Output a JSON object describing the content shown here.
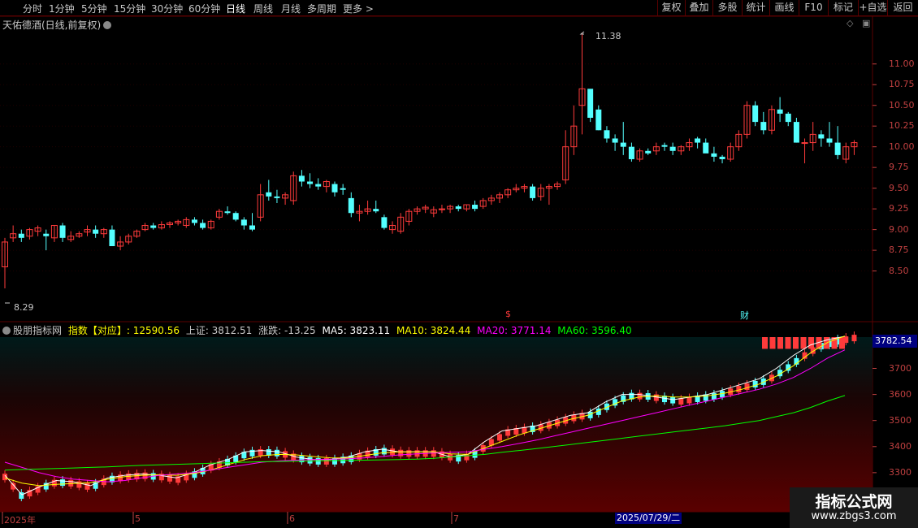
{
  "toolbar": {
    "periods": [
      "分时",
      "1分钟",
      "5分钟",
      "15分钟",
      "30分钟",
      "60分钟",
      "日线",
      "周线",
      "月线",
      "多周期",
      "更多 >"
    ],
    "active_period": "日线",
    "right_buttons": [
      "复权",
      "叠加",
      "多股",
      "统计",
      "画线",
      "F10",
      "+自选",
      "返回"
    ],
    "right_extra": "标记"
  },
  "main_panel": {
    "title": "天佑德酒(日线,前复权)",
    "high_label": "11.38",
    "low_label": "8.29",
    "marker_s": "$",
    "marker_cai": "财",
    "price_axis": [
      "11.00",
      "10.75",
      "10.50",
      "10.25",
      "10.00",
      "9.75",
      "9.50",
      "9.25",
      "9.00",
      "8.75",
      "8.50"
    ]
  },
  "indicator_panel": {
    "title": "股朋指标网",
    "index_label": "指数【对应】",
    "index_value": ": 12590.56",
    "sh_label": "上证: 3812.51",
    "change_label": "涨跌: -13.25",
    "ma5": "MA5: 3823.11",
    "ma10": "MA10: 3824.44",
    "ma20": "MA20: 3771.14",
    "ma60": "MA60: 3596.40",
    "current_value": "3782.54",
    "axis": [
      "3700",
      "3600",
      "3500",
      "3400",
      "3300",
      "3200"
    ]
  },
  "date_axis": {
    "labels": [
      "2025年",
      "5",
      "6",
      "7"
    ],
    "cursor_date": "2025/07/29/二"
  },
  "watermark": {
    "line1": "指标公式网",
    "line2": "www.zbgs3.com"
  },
  "colors": {
    "up": "#ff3b3b",
    "down": "#54ffff",
    "ma5": "#ffffff",
    "ma10": "#ffff00",
    "ma20": "#ff00ff",
    "ma60": "#00ff00",
    "grid": "#5a0000"
  },
  "chart_data": [
    {
      "type": "candlestick",
      "title": "天佑德酒(日线,前复权)",
      "ylim": [
        8.29,
        11.38
      ],
      "candles": [
        [
          8.55,
          8.9,
          8.29,
          8.85
        ],
        [
          8.9,
          9.05,
          8.85,
          8.95
        ],
        [
          8.95,
          9.0,
          8.85,
          8.9
        ],
        [
          8.92,
          9.02,
          8.88,
          9.0
        ],
        [
          8.98,
          9.05,
          8.92,
          9.02
        ],
        [
          8.95,
          9.0,
          8.75,
          8.92
        ],
        [
          8.9,
          9.05,
          8.85,
          9.05
        ],
        [
          9.05,
          9.08,
          8.85,
          8.9
        ],
        [
          8.88,
          8.98,
          8.85,
          8.92
        ],
        [
          8.92,
          8.98,
          8.9,
          8.95
        ],
        [
          8.97,
          9.05,
          8.92,
          9.0
        ],
        [
          9.0,
          9.05,
          8.9,
          8.95
        ],
        [
          8.95,
          9.02,
          8.9,
          9.0
        ],
        [
          9.0,
          9.05,
          8.85,
          8.8
        ],
        [
          8.8,
          8.92,
          8.75,
          8.85
        ],
        [
          8.85,
          8.95,
          8.82,
          8.92
        ],
        [
          8.92,
          9.0,
          8.9,
          8.98
        ],
        [
          9.0,
          9.08,
          8.98,
          9.05
        ],
        [
          9.05,
          9.08,
          9.0,
          9.02
        ],
        [
          9.02,
          9.1,
          9.0,
          9.06
        ],
        [
          9.06,
          9.1,
          9.02,
          9.08
        ],
        [
          9.08,
          9.12,
          9.05,
          9.1
        ],
        [
          9.05,
          9.15,
          9.02,
          9.12
        ],
        [
          9.12,
          9.15,
          9.05,
          9.08
        ],
        [
          9.08,
          9.12,
          9.0,
          9.02
        ],
        [
          9.02,
          9.12,
          9.0,
          9.1
        ],
        [
          9.15,
          9.25,
          9.12,
          9.22
        ],
        [
          9.22,
          9.28,
          9.18,
          9.2
        ],
        [
          9.2,
          9.22,
          9.1,
          9.12
        ],
        [
          9.12,
          9.15,
          9.0,
          9.05
        ],
        [
          9.05,
          9.2,
          8.98,
          9.0
        ],
        [
          9.15,
          9.55,
          9.1,
          9.42
        ],
        [
          9.45,
          9.6,
          9.35,
          9.4
        ],
        [
          9.4,
          9.48,
          9.32,
          9.38
        ],
        [
          9.38,
          9.45,
          9.3,
          9.42
        ],
        [
          9.35,
          9.7,
          9.3,
          9.65
        ],
        [
          9.65,
          9.72,
          9.52,
          9.58
        ],
        [
          9.58,
          9.68,
          9.5,
          9.55
        ],
        [
          9.55,
          9.62,
          9.48,
          9.52
        ],
        [
          9.52,
          9.6,
          9.45,
          9.58
        ],
        [
          9.55,
          9.58,
          9.4,
          9.45
        ],
        [
          9.5,
          9.55,
          9.42,
          9.48
        ],
        [
          9.38,
          9.45,
          9.15,
          9.2
        ],
        [
          9.2,
          9.3,
          9.1,
          9.22
        ],
        [
          9.22,
          9.35,
          9.18,
          9.25
        ],
        [
          9.25,
          9.35,
          9.2,
          9.22
        ],
        [
          9.15,
          9.18,
          9.0,
          9.02
        ],
        [
          9.0,
          9.1,
          8.95,
          9.05
        ],
        [
          8.98,
          9.2,
          8.95,
          9.15
        ],
        [
          9.1,
          9.25,
          9.05,
          9.22
        ],
        [
          9.22,
          9.28,
          9.18,
          9.25
        ],
        [
          9.25,
          9.3,
          9.2,
          9.27
        ],
        [
          9.2,
          9.28,
          9.15,
          9.24
        ],
        [
          9.24,
          9.3,
          9.2,
          9.25
        ],
        [
          9.25,
          9.3,
          9.2,
          9.28
        ],
        [
          9.28,
          9.3,
          9.22,
          9.25
        ],
        [
          9.25,
          9.3,
          9.22,
          9.3
        ],
        [
          9.3,
          9.35,
          9.22,
          9.25
        ],
        [
          9.28,
          9.38,
          9.25,
          9.35
        ],
        [
          9.35,
          9.42,
          9.3,
          9.38
        ],
        [
          9.38,
          9.45,
          9.32,
          9.42
        ],
        [
          9.42,
          9.5,
          9.38,
          9.48
        ],
        [
          9.48,
          9.55,
          9.45,
          9.5
        ],
        [
          9.5,
          9.55,
          9.45,
          9.52
        ],
        [
          9.52,
          9.55,
          9.35,
          9.38
        ],
        [
          9.4,
          9.55,
          9.35,
          9.5
        ],
        [
          9.5,
          9.55,
          9.3,
          9.52
        ],
        [
          9.52,
          9.58,
          9.48,
          9.55
        ],
        [
          9.6,
          10.2,
          9.55,
          10.0
        ],
        [
          10.0,
          10.5,
          9.9,
          10.25
        ],
        [
          10.5,
          11.38,
          10.15,
          10.7
        ],
        [
          10.7,
          10.6,
          10.3,
          10.35
        ],
        [
          10.45,
          10.5,
          10.2,
          10.2
        ],
        [
          10.2,
          10.25,
          10.05,
          10.1
        ],
        [
          10.1,
          10.15,
          9.95,
          10.05
        ],
        [
          10.05,
          10.3,
          9.9,
          10.0
        ],
        [
          10.0,
          10.05,
          9.82,
          9.85
        ],
        [
          9.85,
          9.98,
          9.82,
          9.95
        ],
        [
          9.95,
          9.98,
          9.9,
          9.92
        ],
        [
          9.95,
          10.05,
          9.9,
          10.0
        ],
        [
          10.02,
          10.05,
          9.95,
          10.0
        ],
        [
          10.0,
          10.05,
          9.9,
          9.95
        ],
        [
          9.95,
          10.02,
          9.9,
          10.0
        ],
        [
          10.0,
          10.1,
          9.95,
          10.05
        ],
        [
          10.1,
          10.12,
          9.98,
          10.05
        ],
        [
          10.05,
          10.1,
          9.95,
          9.92
        ],
        [
          9.92,
          10.0,
          9.82,
          9.88
        ],
        [
          9.88,
          9.9,
          9.8,
          9.85
        ],
        [
          9.85,
          10.05,
          9.82,
          10.0
        ],
        [
          10.0,
          10.2,
          9.95,
          10.15
        ],
        [
          10.15,
          10.55,
          10.1,
          10.5
        ],
        [
          10.5,
          10.55,
          10.25,
          10.3
        ],
        [
          10.3,
          10.42,
          10.15,
          10.2
        ],
        [
          10.2,
          10.5,
          10.15,
          10.45
        ],
        [
          10.45,
          10.6,
          10.3,
          10.4
        ],
        [
          10.4,
          10.42,
          10.25,
          10.3
        ],
        [
          10.3,
          10.35,
          10.05,
          10.05
        ],
        [
          10.05,
          10.1,
          9.8,
          10.05
        ],
        [
          10.05,
          10.3,
          9.95,
          10.15
        ],
        [
          10.15,
          10.2,
          10.0,
          10.1
        ],
        [
          10.1,
          10.3,
          10.0,
          10.05
        ],
        [
          10.05,
          10.25,
          9.85,
          9.9
        ],
        [
          9.85,
          10.05,
          9.8,
          10.0
        ],
        [
          10.0,
          10.08,
          9.9,
          10.05
        ]
      ]
    },
    {
      "type": "line",
      "title": "股朋指标网",
      "ylim": [
        3150,
        3820
      ],
      "series": [
        {
          "name": "MA5",
          "values": [
            3290,
            3215,
            3245,
            3270,
            3265,
            3250,
            3280,
            3290,
            3295,
            3290,
            3280,
            3300,
            3330,
            3350,
            3380,
            3385,
            3380,
            3360,
            3350,
            3350,
            3360,
            3380,
            3390,
            3380,
            3380,
            3380,
            3360,
            3370,
            3420,
            3460,
            3470,
            3480,
            3500,
            3520,
            3530,
            3570,
            3600,
            3600,
            3590,
            3580,
            3590,
            3600,
            3620,
            3640,
            3660,
            3700,
            3750,
            3790,
            3810,
            3823
          ]
        },
        {
          "name": "MA10",
          "values": [
            3280,
            3260,
            3250,
            3255,
            3258,
            3262,
            3275,
            3285,
            3290,
            3292,
            3290,
            3296,
            3310,
            3330,
            3350,
            3365,
            3370,
            3368,
            3362,
            3357,
            3356,
            3366,
            3376,
            3380,
            3380,
            3380,
            3372,
            3370,
            3395,
            3420,
            3445,
            3465,
            3485,
            3505,
            3520,
            3548,
            3575,
            3590,
            3595,
            3590,
            3590,
            3595,
            3605,
            3620,
            3640,
            3670,
            3710,
            3760,
            3800,
            3824
          ]
        },
        {
          "name": "MA20",
          "values": [
            3340,
            3320,
            3300,
            3285,
            3275,
            3270,
            3265,
            3270,
            3280,
            3290,
            3295,
            3300,
            3310,
            3320,
            3330,
            3340,
            3345,
            3348,
            3350,
            3352,
            3353,
            3357,
            3362,
            3368,
            3372,
            3375,
            3378,
            3380,
            3390,
            3400,
            3412,
            3425,
            3440,
            3455,
            3470,
            3485,
            3500,
            3515,
            3530,
            3545,
            3560,
            3575,
            3590,
            3605,
            3620,
            3640,
            3665,
            3700,
            3740,
            3771
          ]
        },
        {
          "name": "MA60",
          "values": [
            3310,
            3312,
            3314,
            3316,
            3318,
            3320,
            3322,
            3325,
            3328,
            3330,
            3332,
            3334,
            3336,
            3338,
            3340,
            3342,
            3343,
            3344,
            3345,
            3346,
            3347,
            3348,
            3349,
            3350,
            3352,
            3355,
            3360,
            3365,
            3370,
            3378,
            3385,
            3392,
            3400,
            3408,
            3416,
            3424,
            3432,
            3440,
            3448,
            3456,
            3464,
            3472,
            3480,
            3490,
            3500,
            3515,
            3530,
            3550,
            3575,
            3596
          ]
        }
      ]
    }
  ]
}
